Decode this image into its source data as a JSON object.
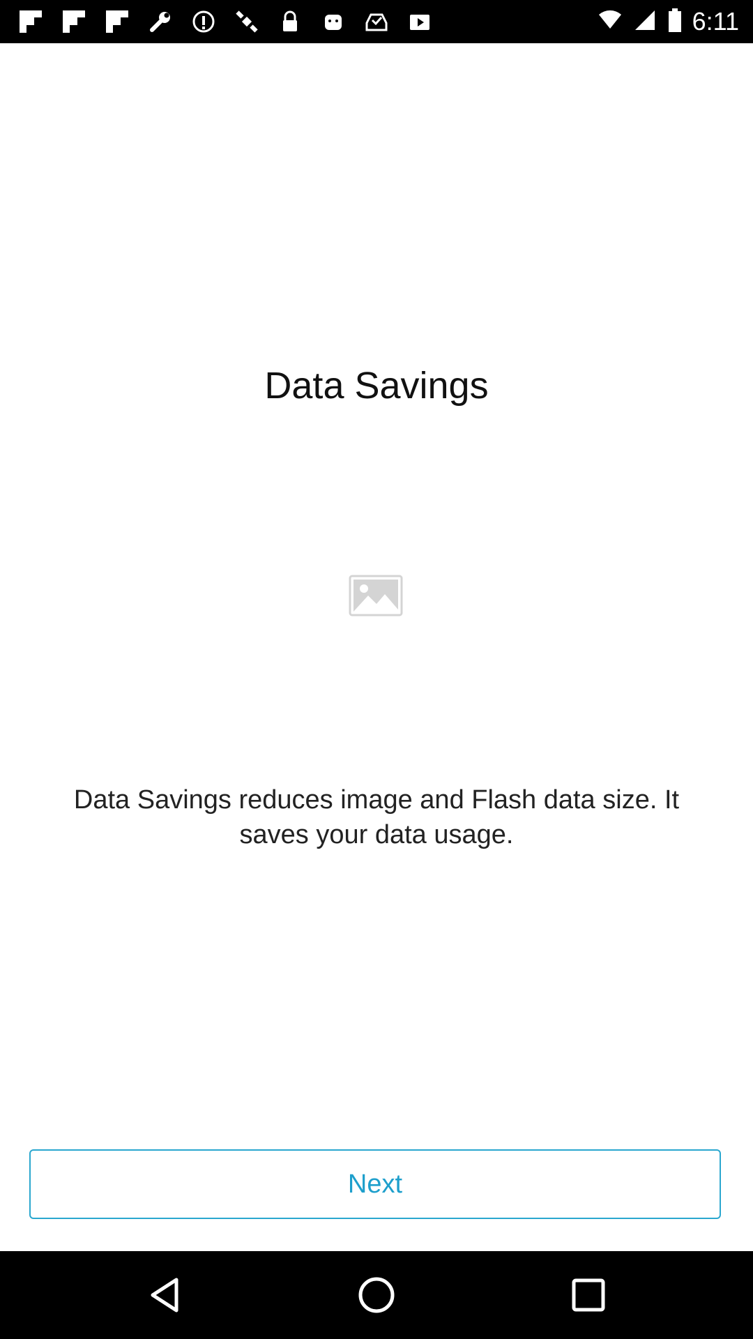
{
  "status_bar": {
    "time": "6:11",
    "icons": [
      "flipboard-icon",
      "flipboard-icon",
      "flipboard-icon",
      "wrench-icon",
      "info-icon",
      "satellite-icon",
      "lock-icon",
      "android-icon",
      "inbox-icon",
      "play-store-icon"
    ],
    "right_icons": [
      "wifi-icon",
      "signal-icon",
      "battery-icon"
    ]
  },
  "screen": {
    "title": "Data Savings",
    "description": "Data Savings reduces image and Flash data size. It saves your data usage.",
    "next_label": "Next"
  },
  "colors": {
    "accent": "#1e9fcc",
    "background": "#ffffff"
  },
  "nav_bar": {
    "icons": [
      "back-icon",
      "home-icon",
      "recents-icon"
    ]
  }
}
